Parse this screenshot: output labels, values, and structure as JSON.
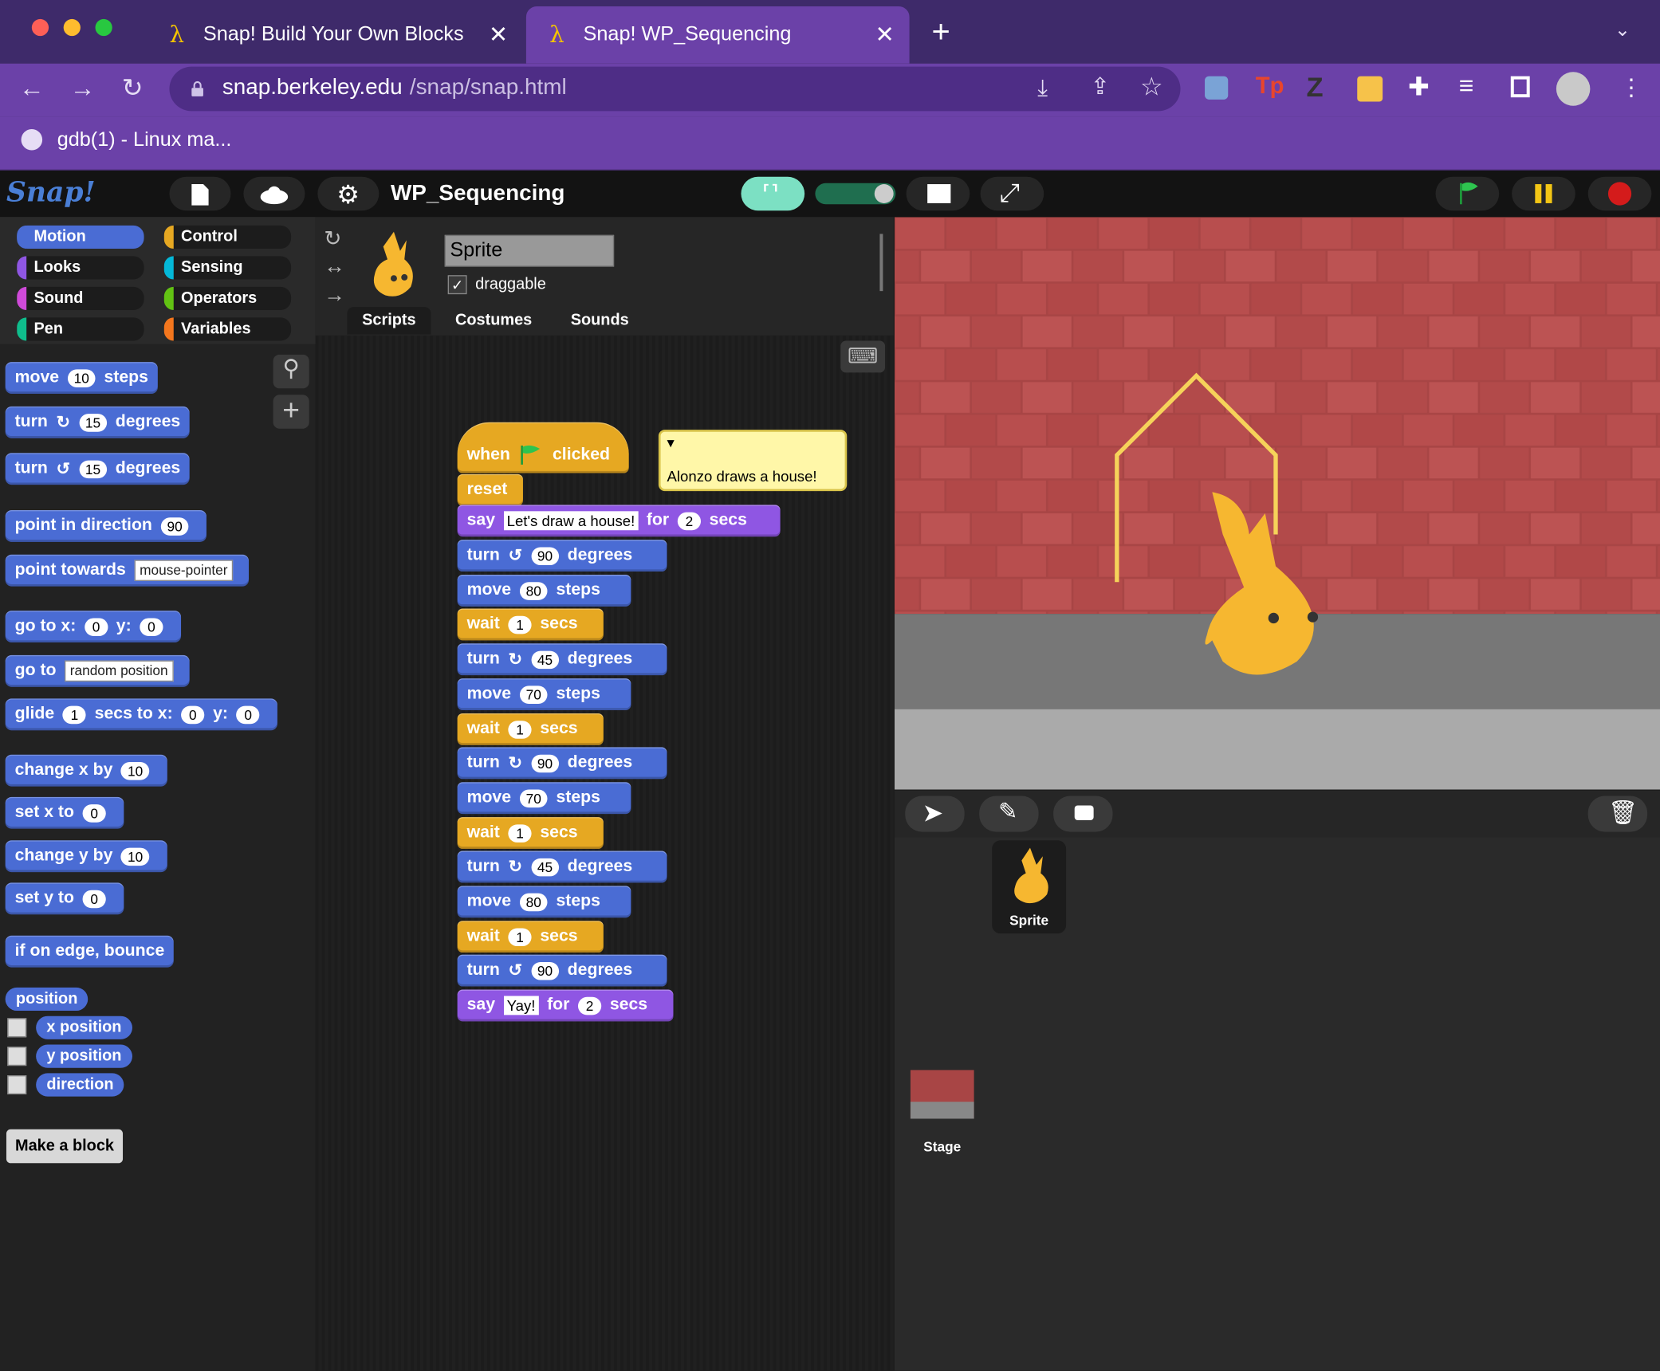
{
  "browser": {
    "tabs": [
      {
        "title": "Snap! Build Your Own Blocks",
        "icon": "lambda-icon"
      },
      {
        "title": "Snap! WP_Sequencing",
        "icon": "lambda-icon"
      }
    ],
    "url_host": "snap.berkeley.edu",
    "url_path": "/snap/snap.html",
    "bookmark": "gdb(1) - Linux ma..."
  },
  "snap": {
    "logo": "Snap!",
    "project_title": "WP_Sequencing",
    "categories": [
      "Motion",
      "Looks",
      "Sound",
      "Pen",
      "Control",
      "Sensing",
      "Operators",
      "Variables"
    ],
    "category_colors": {
      "Motion": "#4a6cd4",
      "Looks": "#8f56e3",
      "Sound": "#cf4ad9",
      "Pen": "#0fbd8c",
      "Control": "#e6a822",
      "Sensing": "#04b8d8",
      "Operators": "#62c213",
      "Variables": "#f3761d"
    },
    "sprite_name": "Sprite",
    "draggable_label": "draggable",
    "editor_tabs": [
      "Scripts",
      "Costumes",
      "Sounds"
    ],
    "palette": {
      "move": {
        "pre": "move",
        "val": "10",
        "post": "steps"
      },
      "turn_cw": {
        "pre": "turn",
        "val": "15",
        "post": "degrees"
      },
      "turn_ccw": {
        "pre": "turn",
        "val": "15",
        "post": "degrees"
      },
      "point_dir": {
        "pre": "point in direction",
        "val": "90"
      },
      "point_towards": {
        "pre": "point towards",
        "val": "mouse-pointer"
      },
      "goto_xy": {
        "pre": "go to x:",
        "x": "0",
        "mid": "y:",
        "y": "0"
      },
      "goto": {
        "pre": "go to",
        "val": "random position"
      },
      "glide": {
        "pre": "glide",
        "val": "1",
        "mid": "secs to x:",
        "x": "0",
        "mid2": "y:",
        "y": "0"
      },
      "change_x": {
        "pre": "change x by",
        "val": "10"
      },
      "set_x": {
        "pre": "set x to",
        "val": "0"
      },
      "change_y": {
        "pre": "change y by",
        "val": "10"
      },
      "set_y": {
        "pre": "set y to",
        "val": "0"
      },
      "bounce": "if on edge, bounce",
      "position": "position",
      "x_position": "x position",
      "y_position": "y position",
      "direction": "direction",
      "make_block": "Make a block"
    },
    "script": {
      "hat": {
        "pre": "when",
        "post": "clicked"
      },
      "reset": "reset",
      "say1": {
        "pre": "say",
        "text": "Let's draw a house!",
        "mid": "for",
        "val": "2",
        "post": "secs"
      },
      "steps": [
        {
          "kind": "turn",
          "dir": "ccw",
          "val": "90",
          "post": "degrees"
        },
        {
          "kind": "move",
          "val": "80",
          "post": "steps"
        },
        {
          "kind": "wait",
          "val": "1",
          "post": "secs"
        },
        {
          "kind": "turn",
          "dir": "cw",
          "val": "45",
          "post": "degrees"
        },
        {
          "kind": "move",
          "val": "70",
          "post": "steps"
        },
        {
          "kind": "wait",
          "val": "1",
          "post": "secs"
        },
        {
          "kind": "turn",
          "dir": "cw",
          "val": "90",
          "post": "degrees"
        },
        {
          "kind": "move",
          "val": "70",
          "post": "steps"
        },
        {
          "kind": "wait",
          "val": "1",
          "post": "secs"
        },
        {
          "kind": "turn",
          "dir": "cw",
          "val": "45",
          "post": "degrees"
        },
        {
          "kind": "move",
          "val": "80",
          "post": "steps"
        },
        {
          "kind": "wait",
          "val": "1",
          "post": "secs"
        },
        {
          "kind": "turn",
          "dir": "ccw",
          "val": "90",
          "post": "degrees"
        }
      ],
      "say2": {
        "pre": "say",
        "text": "Yay!",
        "mid": "for",
        "val": "2",
        "post": "secs"
      },
      "comment": "Alonzo draws a house!"
    },
    "corral": {
      "sprite_label": "Sprite",
      "stage_label": "Stage"
    }
  }
}
